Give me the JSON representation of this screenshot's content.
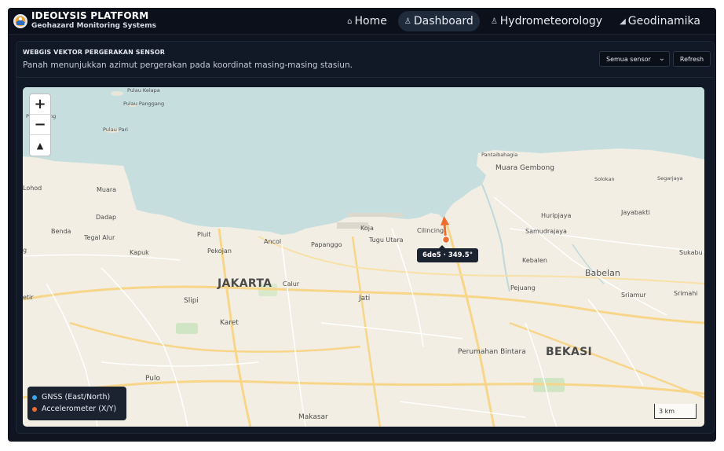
{
  "brand": {
    "title": "IDEOLYSIS PLATFORM",
    "subtitle": "Geohazard Monitoring Systems"
  },
  "nav": {
    "items": [
      {
        "label": "Home",
        "icon": "home-icon",
        "glyph": "⌂",
        "active": false
      },
      {
        "label": "Dashboard",
        "icon": "dashboard-icon",
        "glyph": "♙",
        "active": true
      },
      {
        "label": "Hydrometeorology",
        "icon": "hydro-icon",
        "glyph": "♙",
        "active": false
      },
      {
        "label": "Geodinamika",
        "icon": "chart-bars-icon",
        "glyph": "◢",
        "active": false
      }
    ]
  },
  "panel": {
    "title": "WEBGIS VEKTOR PERGERAKAN SENSOR",
    "description": "Panah menunjukkan azimut pergerakan pada koordinat masing-masing stasiun.",
    "filter_selected": "Semua sensor",
    "refresh_label": "Refresh"
  },
  "map": {
    "zoom_in": "+",
    "zoom_out": "−",
    "reset_north": "▲",
    "scale_label": "3 km",
    "labels": {
      "pulau_kelapa": "Pulau Kelapa",
      "pulau_panggang": "Pulau Panggang",
      "pulau_pari": "Pulau Pari",
      "p_edge": "P",
      "ng_edge": "ng",
      "pantaibahagia": "Pantaibahagia",
      "muara_gembong": "Muara Gembong",
      "solokan": "Solokan",
      "segarjaya": "Segarjaya",
      "lohod": "Lohod",
      "muara": "Muara",
      "huripjaya": "Huripjaya",
      "jayabakti": "Jayabakti",
      "dadap": "Dadap",
      "koja": "Koja",
      "cilincing": "Cilincing",
      "benda": "Benda",
      "tegal_alur": "Tegal Alur",
      "pluit": "Pluit",
      "ancol": "Ancol",
      "tugu_utara": "Tugu Utara",
      "samudrajaya": "Samudrajaya",
      "papanggo": "Papanggo",
      "kapuk": "Kapuk",
      "pekojan": "Pekojan",
      "sukabu": "Sukabu",
      "kebalen": "Kebalen",
      "g_edge": "g",
      "babelan": "Babelan",
      "jakarta": "JAKARTA",
      "calur": "Calur",
      "pejuang": "Pejuang",
      "sriamur": "Sriamur",
      "srimahi": "Srimahi",
      "etir": "etir",
      "slipi": "Slipi",
      "jati": "Jati",
      "karet": "Karet",
      "perumahan_bintara": "Perumahan Bintara",
      "bekasi": "BEKASI",
      "pulo": "Pulo",
      "makasar": "Makasar"
    },
    "tooltip": "6de5 · 349.5°",
    "sensor": {
      "id": "6de5",
      "azimuth_deg": 349.5,
      "type": "Accelerometer (X/Y)"
    }
  },
  "legend": {
    "items": [
      {
        "label": "GNSS (East/North)",
        "color": "#3ba6e8"
      },
      {
        "label": "Accelerometer (X/Y)",
        "color": "#ef6c2f"
      }
    ]
  },
  "colors": {
    "accent_orange": "#ef6c2f",
    "gnss_blue": "#3ba6e8",
    "sea": "#c7dedf",
    "land": "#f2eee3"
  }
}
